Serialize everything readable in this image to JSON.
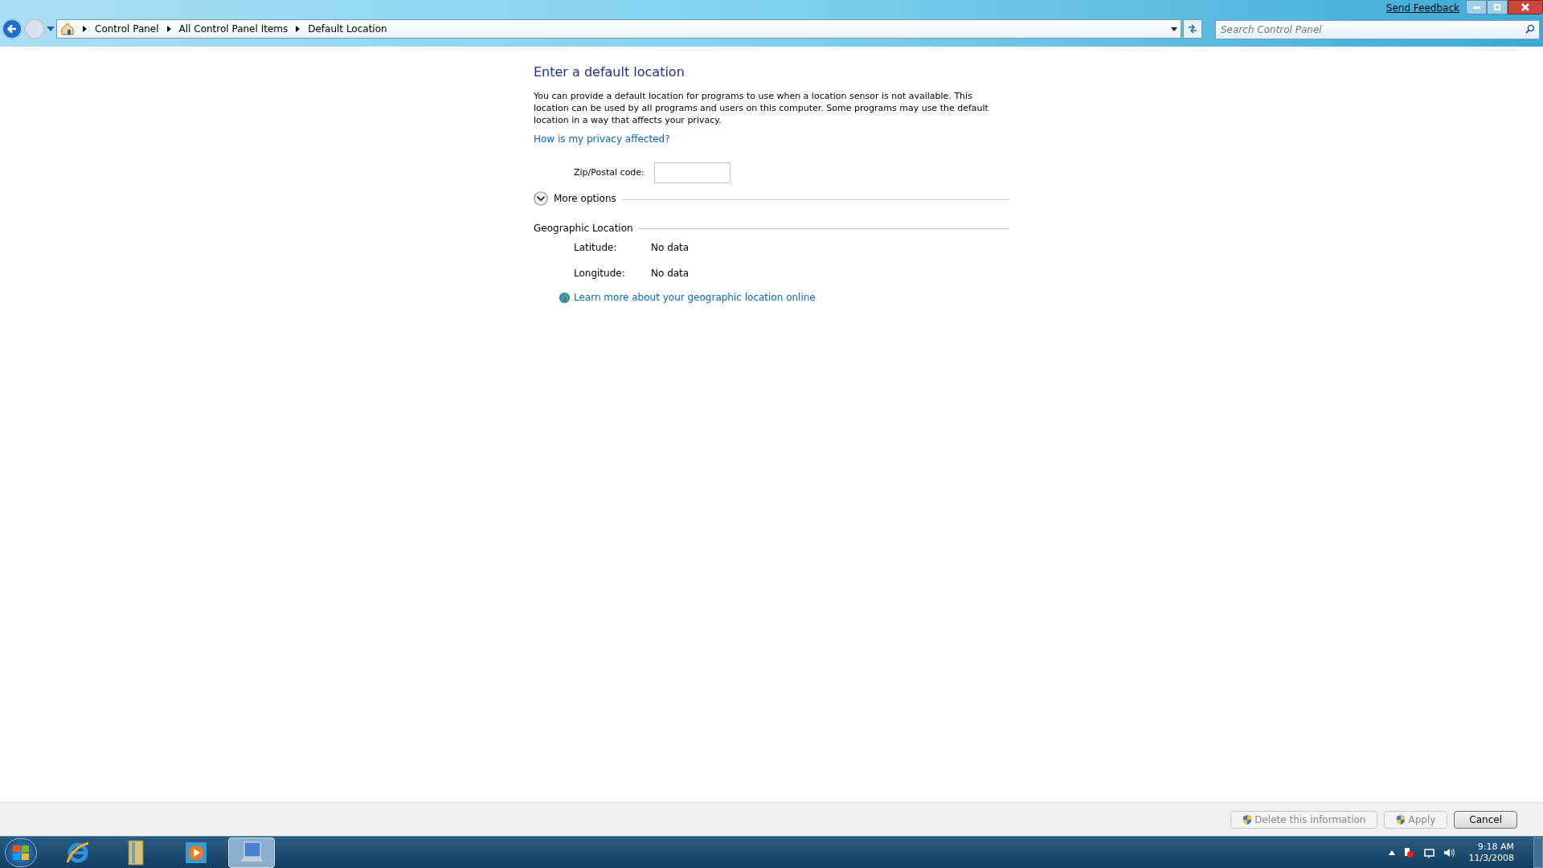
{
  "title_bar": {
    "feedback_link": "Send Feedback"
  },
  "address_bar": {
    "breadcrumbs": [
      "Control Panel",
      "All Control Panel Items",
      "Default Location"
    ]
  },
  "search": {
    "placeholder": "Search Control Panel"
  },
  "content": {
    "heading": "Enter a default location",
    "description": "You can provide a default location for programs to use when a location sensor is not available. This location can be used by all programs and users on this computer. Some programs may use the default location in a way that affects your privacy.",
    "privacy_link": "How is my privacy affected?",
    "zip_label": "Zip/Postal code:",
    "more_options": {
      "label": "More options",
      "expanded": false
    },
    "geo_heading": "Geographic Location",
    "geo_rows": [
      {
        "label": "Latitude:",
        "value": "No data"
      },
      {
        "label": "Longitude:",
        "value": "No data"
      }
    ],
    "learn_link": "Learn more about your geographic location online"
  },
  "buttons": [
    {
      "label": "Delete this information",
      "shield": true,
      "disabled": true
    },
    {
      "label": "Apply",
      "shield": true,
      "disabled": true
    },
    {
      "label": "Cancel",
      "shield": false,
      "disabled": false
    }
  ],
  "taskbar": {
    "time": "9:18 AM",
    "date": "11/3/2008"
  }
}
